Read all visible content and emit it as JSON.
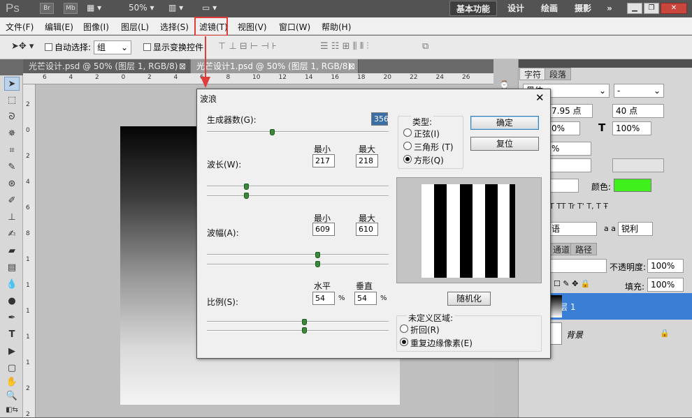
{
  "appbar": {
    "logo": "Ps",
    "br": "Br",
    "mb": "Mb",
    "zoom": "50%",
    "ws_basic": "基本功能",
    "ws_design": "设计",
    "ws_paint": "绘画",
    "ws_photo": "摄影",
    "more": "»"
  },
  "menu": [
    "文件(F)",
    "编辑(E)",
    "图像(I)",
    "图层(L)",
    "选择(S)",
    "滤镜(T)",
    "视图(V)",
    "窗口(W)",
    "帮助(H)"
  ],
  "options": {
    "auto_select": "自动选择:",
    "group_value": "组",
    "show_transform": "显示变换控件"
  },
  "tabs": [
    {
      "label": "光芒设计.psd @ 50% (图层 1, RGB/8)",
      "close": "⊠"
    },
    {
      "label": "光芒设计1.psd @ 50% (图层 1, RGB/8)",
      "close": "⊠"
    }
  ],
  "ruler_h": [
    "6",
    "4",
    "2",
    "0",
    "2",
    "4",
    "6",
    "8",
    "10",
    "12",
    "14",
    "16",
    "18",
    "20",
    "22",
    "24",
    "26"
  ],
  "ruler_v": [
    "2",
    "0",
    "2",
    "4",
    "6",
    "8",
    "1",
    "1",
    "1",
    "1",
    "1",
    "2",
    "2"
  ],
  "right_panel": {
    "tab_char": "字符",
    "tab_para": "段落",
    "font_family": "黑体",
    "font_style": "-",
    "font_size": "7.95 点",
    "leading": "40 点",
    "vscale": "0%",
    "hscale": "100%",
    "tracking": "%",
    "color_label": "颜色:",
    "color": "#3ff01c",
    "type_buttons": "T TT Tr T' T, T Ŧ",
    "lang": "语",
    "aa_label": "a a",
    "aa_value": "锐利",
    "tab_channels": "通道",
    "tab_paths": "路径",
    "opacity_label": "不透明度:",
    "opacity_value": "100%",
    "fill_label": "填充:",
    "fill_value": "100%",
    "layer1": "图层 1",
    "background": "背景"
  },
  "dialog": {
    "title": "波浪",
    "generators_label": "生成器数(G):",
    "generators_value": "356",
    "generators_level": 0.36,
    "min_label": "最小",
    "max_label": "最大",
    "wavelength_label": "波长(W):",
    "wavelength_min": "217",
    "wavelength_max": "218",
    "wavelength_min_level": 0.22,
    "wavelength_max_level": 0.22,
    "amplitude_label": "波幅(A):",
    "amplitude_min": "609",
    "amplitude_max": "610",
    "amplitude_min_level": 0.61,
    "amplitude_max_level": 0.61,
    "scale_label": "比例(S):",
    "horizontal_label": "水平",
    "vertical_label": "垂直",
    "scale_h": "54",
    "scale_v": "54",
    "pct": "%",
    "scale_h_level": 0.54,
    "scale_v_level": 0.54,
    "type_label": "类型:",
    "sine": "正弦(I)",
    "triangle": "三角形 (T)",
    "square": "方形(Q)",
    "ok": "确定",
    "reset": "复位",
    "randomize": "随机化",
    "undefined_label": "未定义区域:",
    "wrap": "折回(R)",
    "repeat_edge": "重复边缘像素(E)"
  }
}
